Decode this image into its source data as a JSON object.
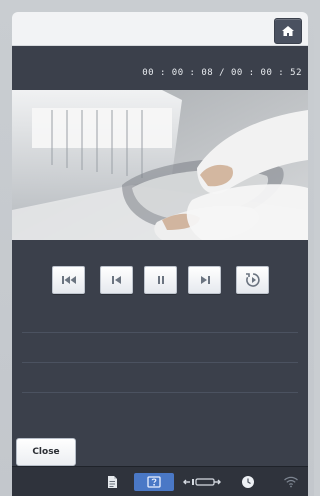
{
  "header": {
    "home_icon": "home-icon"
  },
  "player": {
    "time_display": "00 : 00 : 08 / 00 : 00 : 52",
    "controls": [
      {
        "name": "skip-to-start",
        "icon": "skip-to-start-icon"
      },
      {
        "name": "previous",
        "icon": "previous-icon"
      },
      {
        "name": "pause",
        "icon": "pause-icon"
      },
      {
        "name": "next",
        "icon": "next-icon"
      },
      {
        "name": "replay",
        "icon": "replay-icon"
      }
    ]
  },
  "actions": {
    "close_label": "Close"
  },
  "statusbar": {
    "items": [
      {
        "icon": "document-icon"
      },
      {
        "icon": "help-icon",
        "active": true
      },
      {
        "icon": "hoop-icon"
      },
      {
        "icon": "clock-icon"
      },
      {
        "icon": "wifi-icon"
      }
    ]
  },
  "colors": {
    "panel": "#3b404b",
    "accent": "#4a78c6"
  }
}
